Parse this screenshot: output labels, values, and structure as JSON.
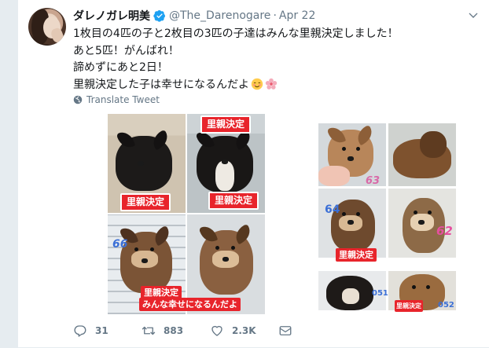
{
  "tweet": {
    "author_name": "ダレノガレ明美",
    "handle": "@The_Darenogare",
    "separator": "·",
    "date": "Apr 22",
    "lines": [
      "1枚目の4匹の子と2枚目の3匹の子達はみんな里親決定しました！",
      "あと5匹！がんばれ！",
      "諦めずにあと2日！",
      "里親決定した子は幸せになるんだよ"
    ],
    "translate_label": "Translate Tweet"
  },
  "media": {
    "left_tags": [
      "里親決定",
      "里親決定",
      "里親決定",
      "里親決定",
      "みんな幸せになるんだよ"
    ],
    "left_numbers": [
      "66"
    ],
    "right_numbers": [
      "64",
      "62",
      "63",
      "051",
      "052"
    ],
    "right_tags": [
      "里親決定",
      "里親決定"
    ]
  },
  "actions": {
    "reply_count": "31",
    "retweet_count": "883",
    "like_count": "2.3K"
  },
  "colors": {
    "accent": "#1da1f2",
    "tag_red": "#e8242b",
    "muted": "#657786"
  }
}
